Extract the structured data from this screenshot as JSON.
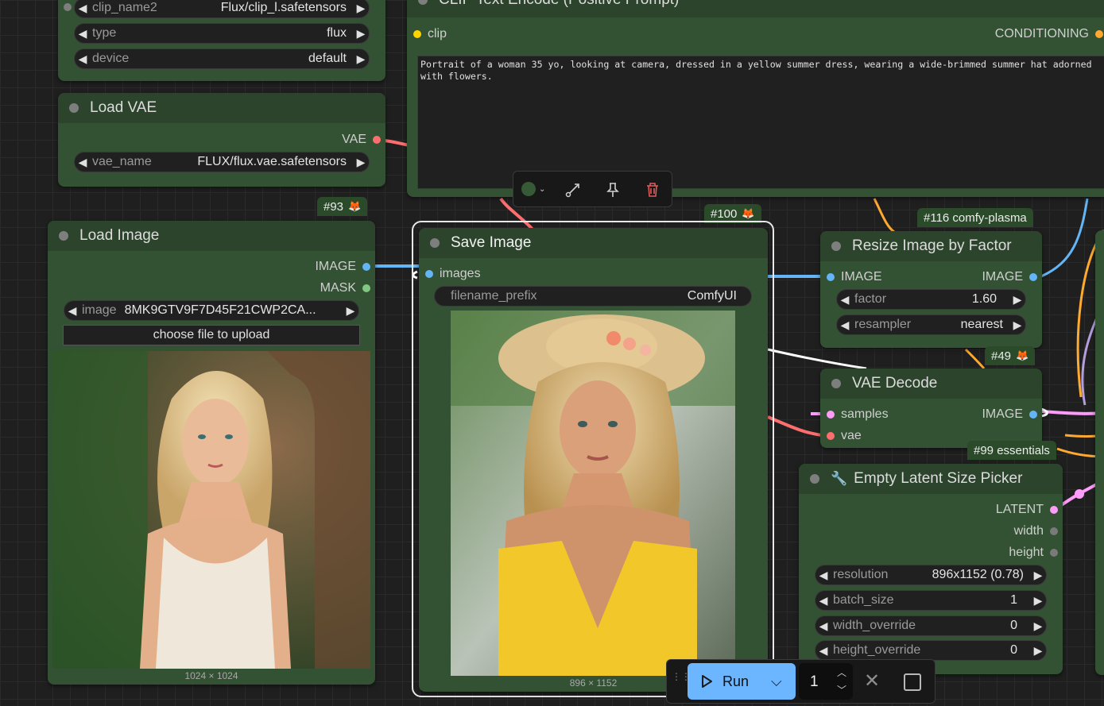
{
  "colors": {
    "node_bg": "#335133",
    "node_header": "#2b442b",
    "canvas": "#1f1f1f",
    "run_button": "#6cb6ff",
    "link_image": "#64b5f6",
    "link_vae": "#ff6e6e",
    "link_latent": "#ff9cf9",
    "link_clip": "#ffd500",
    "link_conditioning": "#ffa931"
  },
  "clip_loader": {
    "widgets": [
      {
        "label": "clip_name2",
        "value": "Flux/clip_l.safetensors"
      },
      {
        "label": "type",
        "value": "flux"
      },
      {
        "label": "device",
        "value": "default"
      }
    ]
  },
  "load_vae": {
    "title": "Load VAE",
    "output": "VAE",
    "widget": {
      "label": "vae_name",
      "value": "FLUX/flux.vae.safetensors"
    }
  },
  "clip_encode": {
    "title": "CLIP Text Encode (Positive Prompt)",
    "input": "clip",
    "output": "CONDITIONING",
    "prompt": "Portrait of a woman 35 yo, looking at camera, dressed in a yellow summer dress, wearing a wide-brimmed summer hat adorned with flowers."
  },
  "node_toolbar": {
    "icons": [
      "color-picker-icon",
      "bypass-icon",
      "pin-icon",
      "delete-icon"
    ]
  },
  "load_image": {
    "badge": "#93",
    "title": "Load Image",
    "outputs": [
      "IMAGE",
      "MASK"
    ],
    "widget": {
      "label": "image",
      "value": "8MK9GTV9F7D45F21CWP2CA..."
    },
    "upload_label": "choose file to upload",
    "dimensions": "1024 × 1024"
  },
  "save_image": {
    "badge": "#100",
    "title": "Save Image",
    "input": "images",
    "widget": {
      "label": "filename_prefix",
      "value": "ComfyUI"
    },
    "dimensions": "896 × 1152"
  },
  "resize_image": {
    "badge": "#116 comfy-plasma",
    "title": "Resize Image by Factor",
    "input": "IMAGE",
    "output": "IMAGE",
    "widgets": [
      {
        "label": "factor",
        "value": "1.60"
      },
      {
        "label": "resampler",
        "value": "nearest"
      }
    ]
  },
  "vae_decode": {
    "badge": "#49",
    "title": "VAE Decode",
    "inputs": [
      "samples",
      "vae"
    ],
    "output": "IMAGE"
  },
  "empty_latent": {
    "badge": "#99 essentials",
    "title": "Empty Latent Size Picker",
    "outputs": [
      "LATENT",
      "width",
      "height"
    ],
    "widgets": [
      {
        "label": "resolution",
        "value": "896x1152 (0.78)"
      },
      {
        "label": "batch_size",
        "value": "1"
      },
      {
        "label": "width_override",
        "value": "0"
      },
      {
        "label": "height_override",
        "value": "0"
      }
    ]
  },
  "run_bar": {
    "run_label": "Run",
    "count": "1"
  }
}
